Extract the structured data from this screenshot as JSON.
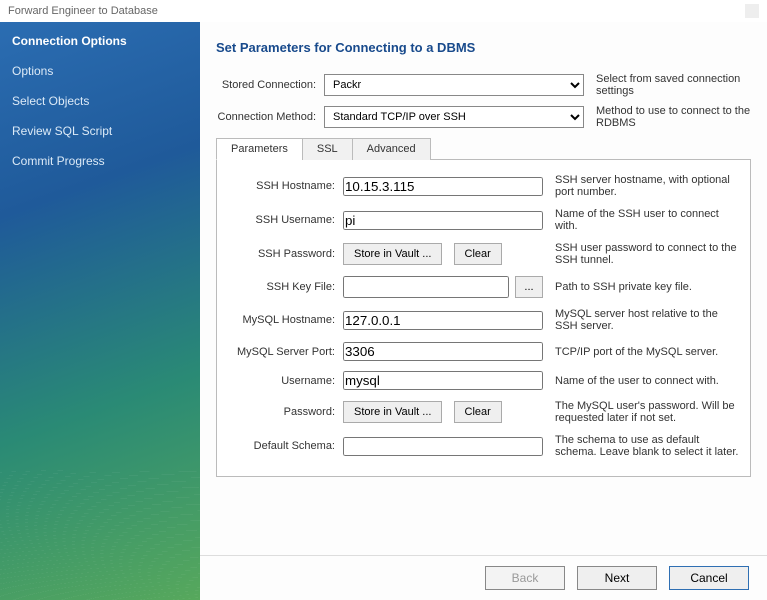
{
  "window": {
    "title": "Forward Engineer to Database"
  },
  "sidebar": {
    "items": [
      {
        "label": "Connection Options",
        "active": true
      },
      {
        "label": "Options"
      },
      {
        "label": "Select Objects"
      },
      {
        "label": "Review SQL Script"
      },
      {
        "label": "Commit Progress"
      }
    ]
  },
  "main": {
    "heading": "Set Parameters for Connecting to a DBMS",
    "stored_connection": {
      "label": "Stored Connection:",
      "value": "Packr",
      "hint": "Select from saved connection settings"
    },
    "connection_method": {
      "label": "Connection Method:",
      "value": "Standard TCP/IP over SSH",
      "hint": "Method to use to connect to the RDBMS"
    },
    "tabs": [
      {
        "label": "Parameters",
        "active": true
      },
      {
        "label": "SSL"
      },
      {
        "label": "Advanced"
      }
    ],
    "params": {
      "ssh_hostname": {
        "label": "SSH Hostname:",
        "value": "10.15.3.115",
        "hint": "SSH server hostname, with  optional port number."
      },
      "ssh_username": {
        "label": "SSH Username:",
        "value": "pi",
        "hint": "Name of the SSH user to connect with."
      },
      "ssh_password": {
        "label": "SSH Password:",
        "store": "Store in Vault ...",
        "clear": "Clear",
        "hint": "SSH user password to connect to the SSH tunnel."
      },
      "ssh_keyfile": {
        "label": "SSH Key File:",
        "value": "",
        "browse": "...",
        "hint": "Path to SSH private key file."
      },
      "mysql_hostname": {
        "label": "MySQL Hostname:",
        "value": "127.0.0.1",
        "hint": "MySQL server host relative to the SSH server."
      },
      "mysql_port": {
        "label": "MySQL Server Port:",
        "value": "3306",
        "hint": "TCP/IP port of the MySQL server."
      },
      "username": {
        "label": "Username:",
        "value": "mysql",
        "hint": "Name of the user to connect with."
      },
      "password": {
        "label": "Password:",
        "store": "Store in Vault ...",
        "clear": "Clear",
        "hint": "The MySQL user's password. Will be requested later if not set."
      },
      "default_schema": {
        "label": "Default Schema:",
        "value": "",
        "hint": "The schema to use as default schema. Leave blank to select it later."
      }
    }
  },
  "footer": {
    "back": "Back",
    "next": "Next",
    "cancel": "Cancel"
  }
}
